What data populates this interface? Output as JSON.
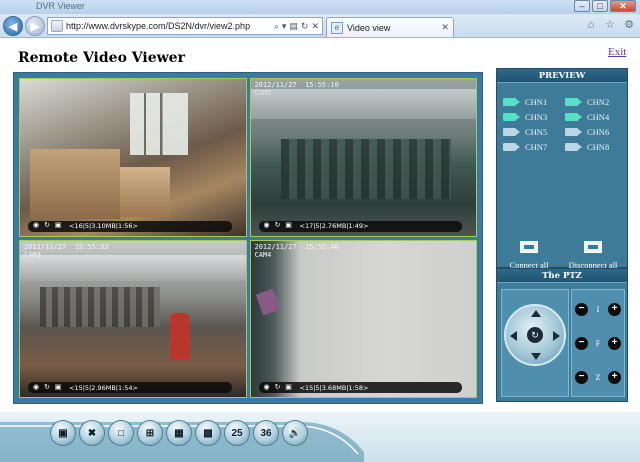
{
  "browser": {
    "title": "DVR Viewer",
    "url": "http://www.dvrskype.com/DS2N/dvr/view2.php",
    "tab_label": "Video view"
  },
  "page": {
    "title": "Remote Video Viewer",
    "exit_label": "Exit"
  },
  "cameras": [
    {
      "label": "",
      "info": "<16|5|3.10MB|1:56>"
    },
    {
      "label": "2012/11/27  15:55:10\nCAM2",
      "info": "<17|5|2.76MB|1:49>"
    },
    {
      "label": "2012/11/27  15:55:33\nCAM3",
      "info": "<15|5|2.96MB|1:54>"
    },
    {
      "label": "2012/11/27  15:55:40\nCAM4",
      "info": "<15|5|3.68MB|1:58>"
    }
  ],
  "preview": {
    "heading": "PREVIEW",
    "channels": [
      {
        "label": "CHN1",
        "active": true
      },
      {
        "label": "CHN2",
        "active": true
      },
      {
        "label": "CHN3",
        "active": true
      },
      {
        "label": "CHN4",
        "active": true
      },
      {
        "label": "CHN5",
        "active": false
      },
      {
        "label": "CHN6",
        "active": false
      },
      {
        "label": "CHN7",
        "active": false
      },
      {
        "label": "CHN8",
        "active": false
      }
    ],
    "connect_all": "Connect all",
    "disconnect_all": "Disconnect all"
  },
  "ptz": {
    "heading": "The PTZ",
    "rows": [
      {
        "letter": "I"
      },
      {
        "letter": "F"
      },
      {
        "letter": "Z"
      }
    ]
  },
  "toolbar": {
    "buttons": [
      {
        "name": "record-icon",
        "glyph": "▣"
      },
      {
        "name": "settings-tools-icon",
        "glyph": "✖"
      },
      {
        "name": "layout-1-icon",
        "glyph": "□"
      },
      {
        "name": "layout-4-icon",
        "glyph": "⊞"
      },
      {
        "name": "layout-9-icon",
        "glyph": "▦"
      },
      {
        "name": "layout-16-icon",
        "glyph": "▩"
      },
      {
        "name": "layout-25-icon",
        "glyph": "25"
      },
      {
        "name": "layout-36-icon",
        "glyph": "36"
      },
      {
        "name": "audio-icon",
        "glyph": "🔊"
      }
    ]
  }
}
